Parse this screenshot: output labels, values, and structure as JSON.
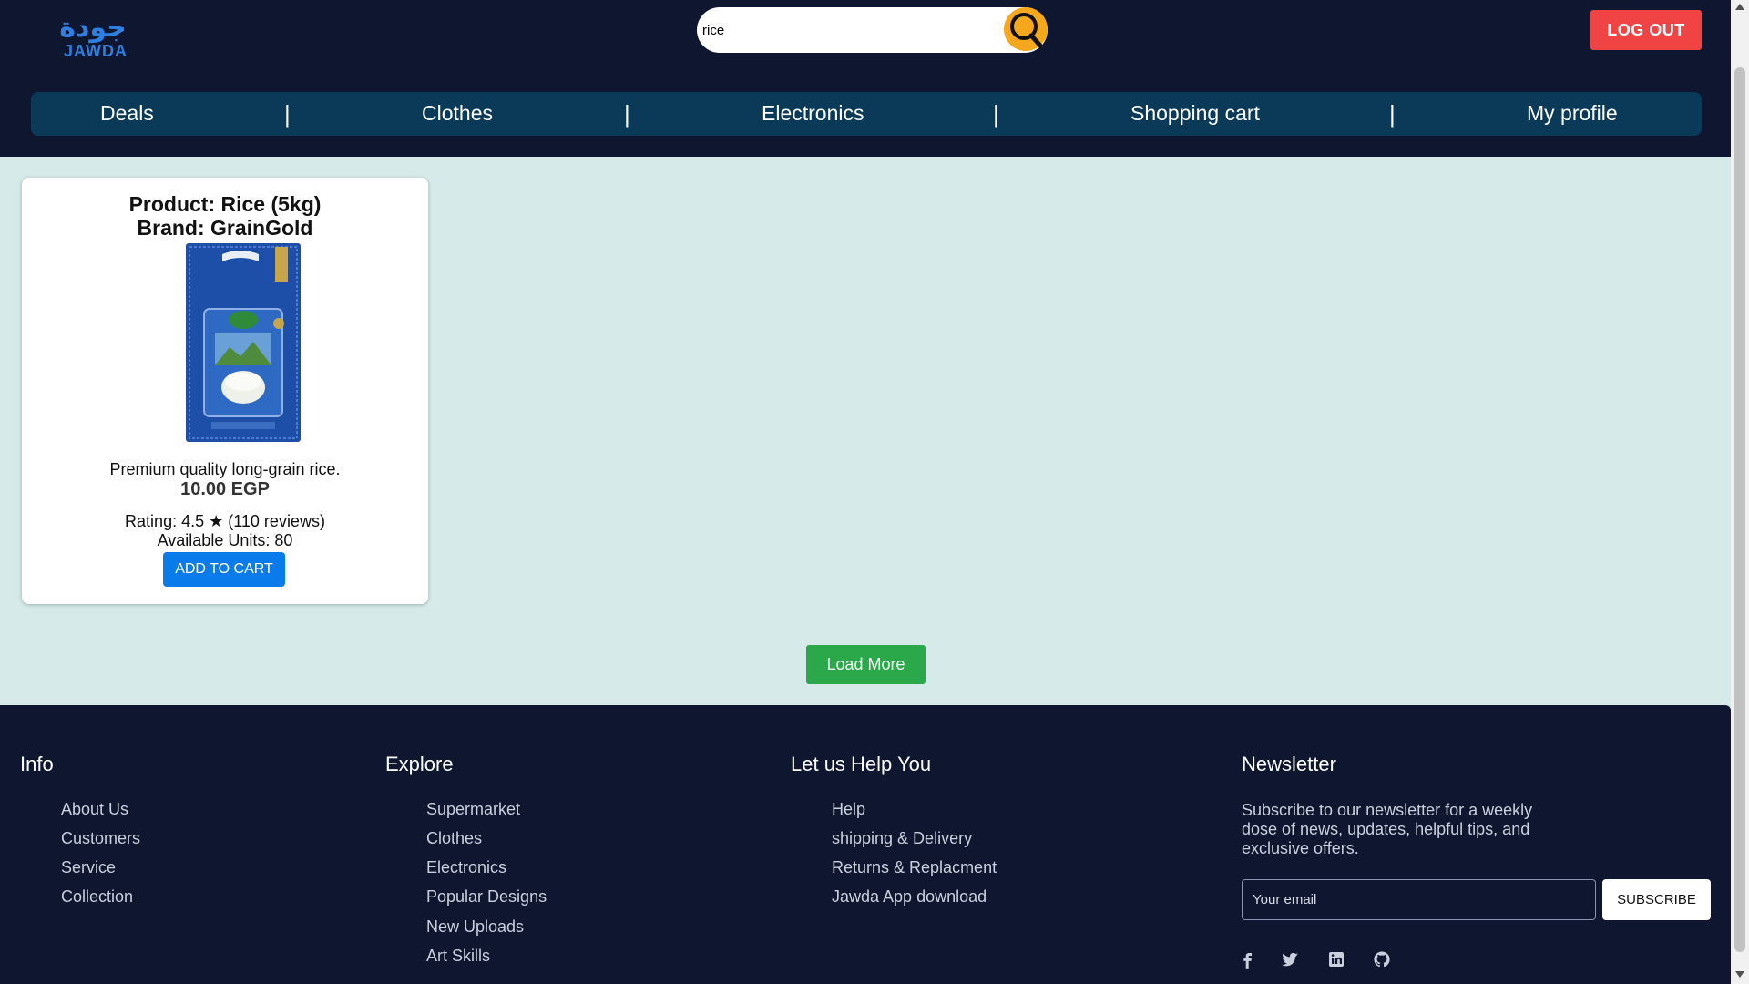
{
  "header": {
    "logo_arabic": "جودة",
    "logo_english": "JAWDA",
    "search": {
      "value": "rice",
      "icon": "search-icon"
    },
    "logout_label": "LOG OUT",
    "colors": {
      "background": "#0e1630",
      "search_button": "#f5a81c",
      "logout": "#f04343",
      "nav": "#0b3a58"
    }
  },
  "nav": {
    "items": [
      {
        "label": "Deals"
      },
      {
        "label": "Clothes"
      },
      {
        "label": "Electronics"
      },
      {
        "label": "Shopping cart"
      },
      {
        "label": "My profile"
      }
    ],
    "separator": "|"
  },
  "product": {
    "title": "Product: Rice (5kg)",
    "brand": "Brand: GrainGold",
    "description": "Premium quality long-grain rice.",
    "price": "10.00 EGP",
    "rating": "Rating: 4.5 ★ (110 reviews)",
    "units": "Available Units: 80",
    "add_label": "ADD TO CART"
  },
  "load_more_label": "Load More",
  "footer": {
    "info": {
      "heading": "Info",
      "links": [
        "About Us",
        "Customers",
        "Service",
        "Collection"
      ]
    },
    "explore": {
      "heading": "Explore",
      "links": [
        "Supermarket",
        "Clothes",
        "Electronics",
        "Popular Designs",
        "New Uploads",
        "Art Skills"
      ]
    },
    "help": {
      "heading": "Let us Help You",
      "links": [
        "Help",
        "shipping & Delivery",
        "Returns & Replacment",
        "Jawda App download"
      ]
    },
    "newsletter": {
      "heading": "Newsletter",
      "text": "Subscribe to our newsletter for a weekly dose of news, updates, helpful tips, and exclusive offers.",
      "email_placeholder": "Your email",
      "subscribe_label": "SUBSCRIBE"
    },
    "social": [
      "facebook-icon",
      "twitter-icon",
      "linkedin-icon",
      "github-icon"
    ]
  }
}
